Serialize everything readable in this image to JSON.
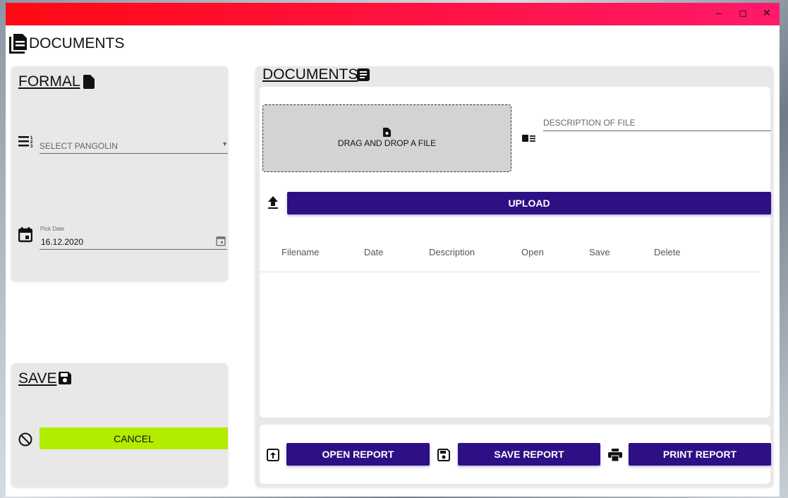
{
  "window": {
    "title": "DOCUMENTS",
    "controls": [
      "minimize",
      "maximize",
      "close"
    ]
  },
  "formal": {
    "heading": "FORMAL",
    "select_placeholder": "SELECT PANGOLIN",
    "date_label": "Pick Date",
    "date_value": "16.12.2020"
  },
  "save": {
    "heading": "SAVE",
    "cancel_label": "CANCEL"
  },
  "documents": {
    "heading": "DOCUMENTS",
    "dropzone_label": "DRAG AND DROP A FILE",
    "description_placeholder": "DESCRIPTION OF FILE",
    "upload_label": "UPLOAD",
    "columns": [
      "Filename",
      "Date",
      "Description",
      "Open",
      "Save",
      "Delete"
    ]
  },
  "report": {
    "open_label": "OPEN REPORT",
    "save_label": "SAVE REPORT",
    "print_label": "PRINT REPORT"
  },
  "colors": {
    "primary": "#2e0f86",
    "cancel": "#b2ec00",
    "titlebar": "#ff0a14"
  }
}
